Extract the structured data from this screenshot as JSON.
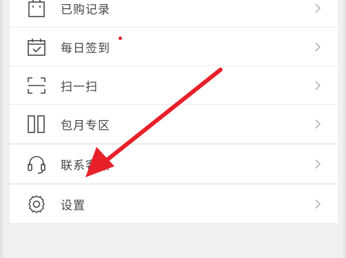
{
  "menu": {
    "group1": [
      {
        "label": "已购记录",
        "icon": "shopping-bag-icon"
      },
      {
        "label": "每日签到",
        "icon": "calendar-check-icon",
        "badge": "red-dot"
      },
      {
        "label": "扫一扫",
        "icon": "scan-icon"
      },
      {
        "label": "包月专区",
        "icon": "books-icon"
      }
    ],
    "group2": [
      {
        "label": "联系客服",
        "icon": "headset-icon"
      }
    ],
    "group3": [
      {
        "label": "设置",
        "icon": "gear-icon"
      }
    ]
  },
  "colors": {
    "background": "#f0f0f0",
    "card": "#ffffff",
    "text": "#444444",
    "badge": "#e8202a",
    "annotation_arrow": "#e8202a"
  }
}
